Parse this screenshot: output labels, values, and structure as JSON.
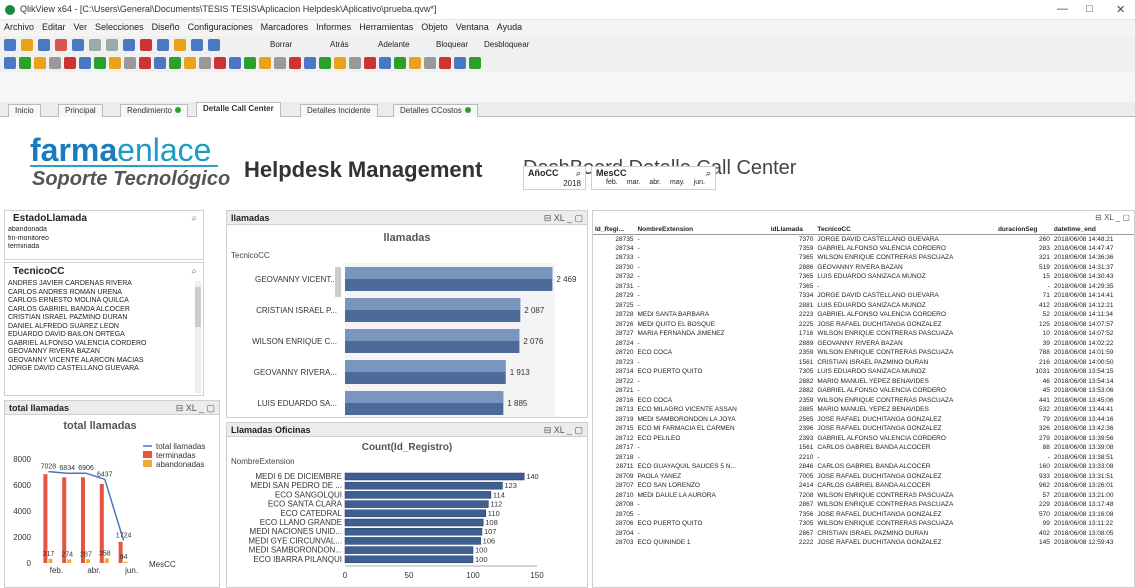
{
  "window": {
    "title": "QlikView x64 - [C:\\Users\\General\\Documents\\TESIS TESIS\\Aplicacion Helpdesk\\Aplicativo\\prueba.qvw*]",
    "min": "—",
    "max": "□",
    "close": "✕"
  },
  "menu": [
    "Archivo",
    "Editar",
    "Ver",
    "Selecciones",
    "Diseño",
    "Configuraciones",
    "Marcadores",
    "Informes",
    "Herramientas",
    "Objeto",
    "Ventana",
    "Ayuda"
  ],
  "toolbar": {
    "borrar": "Borrar",
    "atras": "Atrás",
    "adelante": "Adelante",
    "bloquear": "Bloquear",
    "desbloquear": "Desbloquear"
  },
  "tabs": [
    {
      "label": "Inicio"
    },
    {
      "label": "Principal"
    },
    {
      "label": "Rendimiento"
    },
    {
      "label": "Detalle Call Center"
    },
    {
      "label": "Detalles Incidente"
    },
    {
      "label": "Detalles CCostos"
    }
  ],
  "brand": {
    "farma": "farma",
    "enlace": "enlace",
    "sub": "Soporte Tecnológico"
  },
  "header": {
    "title": "Helpdesk Management",
    "subtitle": "DashBoard Detalle Call Center"
  },
  "anio": {
    "label": "AñoCC",
    "value": "2018"
  },
  "mes": {
    "label": "MesCC",
    "values": [
      "feb.",
      "mar.",
      "abr.",
      "may.",
      "jun."
    ]
  },
  "estado": {
    "title": "EstadoLlamada",
    "items": [
      "abandonada",
      "fin-monitoreo",
      "terminada"
    ]
  },
  "tecnico": {
    "title": "TecnicoCC",
    "items": [
      "ANDRES JAVIER CARDENAS RIVERA",
      "CARLOS ANDRES ROMAN URENA",
      "CARLOS ERNESTO MOLINA QUILCA",
      "CARLOS GABRIEL BANDA ALCOCER",
      "CRISTIAN ISRAEL PAZMINO DURAN",
      "DANIEL ALFREDO SUAREZ LEON",
      "EDUARDO DAVID BAILON ORTEGA",
      "GABRIEL ALFONSO VALENCIA CORDERO",
      "GEOVANNY RIVERA BAZAN",
      "GEOVANNY VICENTE ALARCON MACIAS",
      "JORGE DAVID CASTELLANO GUEVARA"
    ]
  },
  "llamadas_box": {
    "title": "llamadas",
    "chart_title": "llamadas",
    "dim": "TecnicoCC",
    "controls": "⊟ XL _ ▢"
  },
  "oficinas_box": {
    "title": "Llamadas Oficinas",
    "chart_title": "Count(Id_Registro)",
    "dim": "NombreExtension",
    "controls": "⊟ XL _ ▢"
  },
  "total_box": {
    "title": "total llamadas",
    "chart_title": "total llamadas",
    "xlabel": "MesCC",
    "controls": "⊟ XL _ ▢"
  },
  "detail": {
    "controls": "⊟ XL _ ▢",
    "columns": [
      "Id_Regi...",
      "NombreExtension",
      "idLlamada",
      "TecnicoCC",
      "duracionSeg",
      "datetime_end"
    ],
    "rows": [
      [
        "28735",
        "-",
        "7370",
        "JORGE DAVID CASTELLANO GUEVARA",
        "260",
        "2018/06/08 14:48:21"
      ],
      [
        "28734",
        "-",
        "7359",
        "GABRIEL ALFONSO VALENCIA CORDERO",
        "283",
        "2018/06/08 14:47:47"
      ],
      [
        "28733",
        "-",
        "7365",
        "WILSON ENRIQUE CONTRERAS PASCUAZA",
        "321",
        "2018/06/08 14:36:36"
      ],
      [
        "28730",
        "-",
        "2886",
        "GEOVANNY RIVERA BAZAN",
        "519",
        "2018/06/08 14:31:37"
      ],
      [
        "28732",
        "-",
        "7365",
        "LUIS EDUARDO SANIZACA MUNOZ",
        "15",
        "2018/06/08 14:30:43"
      ],
      [
        "28731",
        "-",
        "7365",
        "-",
        "-",
        "2018/06/08 14:29:35"
      ],
      [
        "28729",
        "-",
        "7334",
        "JORGE DAVID CASTELLANO GUEVARA",
        "71",
        "2018/06/08 14:14:41"
      ],
      [
        "28725",
        "-",
        "2881",
        "LUIS EDUARDO SANIZACA MUNOZ",
        "412",
        "2018/06/08 14:12:21"
      ],
      [
        "28728",
        "MEDI SANTA BARBARA",
        "2223",
        "GABRIEL ALFONSO VALENCIA CORDERO",
        "52",
        "2018/06/08 14:11:34"
      ],
      [
        "28726",
        "MEDI QUITO EL BOSQUE",
        "2225",
        "JOSE RAFAEL DUCHITANGA GONZALEZ",
        "125",
        "2018/06/08 14:07:57"
      ],
      [
        "28727",
        "MARIA FERNANDA JIMENEZ",
        "1716",
        "WILSON ENRIQUE CONTRERAS PASCUAZA",
        "10",
        "2018/06/08 14:07:52"
      ],
      [
        "28724",
        "-",
        "2889",
        "GEOVANNY RIVERA BAZAN",
        "39",
        "2018/06/08 14:02:22"
      ],
      [
        "28720",
        "ECO COCA",
        "2359",
        "WILSON ENRIQUE CONTRERAS PASCUAZA",
        "788",
        "2018/06/08 14:01:59"
      ],
      [
        "28723",
        "-",
        "1561",
        "CRISTIAN ISRAEL PAZMINO DURAN",
        "216",
        "2018/06/08 14:00:50"
      ],
      [
        "28714",
        "ECO PUERTO QUITO",
        "7305",
        "LUIS EDUARDO SANIZACA MUNOZ",
        "1031",
        "2018/06/08 13:54:15"
      ],
      [
        "28722",
        "-",
        "2882",
        "MARIO MANUEL YEPEZ BENAVIDES",
        "46",
        "2018/06/08 13:54:14"
      ],
      [
        "28721",
        "-",
        "2882",
        "GABRIEL ALFONSO VALENCIA CORDERO",
        "45",
        "2018/06/08 13:53:06"
      ],
      [
        "28716",
        "ECO COCA",
        "2359",
        "WILSON ENRIQUE CONTRERAS PASCUAZA",
        "441",
        "2018/06/08 13:45:06"
      ],
      [
        "28713",
        "ECO MILAGRO VICENTE ASSAN",
        "2885",
        "MARIO MANUEL YEPEZ BENAVIDES",
        "532",
        "2018/06/08 13:44:41"
      ],
      [
        "28719",
        "MEDI SAMBORONDON LA JOYA",
        "2565",
        "JOSE RAFAEL DUCHITANGA GONZALEZ",
        "79",
        "2018/06/08 13:44:16"
      ],
      [
        "28715",
        "ECO MI FARMACIA EL CARMEN",
        "2396",
        "JOSE RAFAEL DUCHITANGA GONZALEZ",
        "326",
        "2018/06/08 13:42:36"
      ],
      [
        "28712",
        "ECO PELILEO",
        "2393",
        "GABRIEL ALFONSO VALENCIA CORDERO",
        "279",
        "2018/06/08 13:39:56"
      ],
      [
        "28717",
        "-",
        "1561",
        "CARLOS GABRIEL BANDA ALCOCER",
        "88",
        "2018/06/08 13:39:08"
      ],
      [
        "28718",
        "-",
        "2210",
        "-",
        "-",
        "2018/06/08 13:38:51"
      ],
      [
        "28711",
        "ECO GUAYAQUIL SAUCES 5 N...",
        "2846",
        "CARLOS GABRIEL BANDA ALCOCER",
        "160",
        "2018/06/08 13:33:08"
      ],
      [
        "28709",
        "PAOLA YANEZ",
        "7005",
        "JOSE RAFAEL DUCHITANGA GONZALEZ",
        "933",
        "2018/06/08 13:31:51"
      ],
      [
        "28707",
        "ECO SAN LORENZO",
        "2414",
        "CARLOS GABRIEL BANDA ALCOCER",
        "962",
        "2018/06/08 13:26:01"
      ],
      [
        "28710",
        "MEDI DAULE LA AURORA",
        "7208",
        "WILSON ENRIQUE CONTRERAS PASCUAZA",
        "57",
        "2018/06/08 13:21:00"
      ],
      [
        "28708",
        "-",
        "2867",
        "WILSON ENRIQUE CONTRERAS PASCUAZA",
        "229",
        "2018/06/08 13:17:48"
      ],
      [
        "28705",
        "-",
        "7356",
        "JOSE RAFAEL DUCHITANGA GONZALEZ",
        "570",
        "2018/06/08 13:16:08"
      ],
      [
        "28706",
        "ECO PUERTO QUITO",
        "7305",
        "WILSON ENRIQUE CONTRERAS PASCUAZA",
        "99",
        "2018/06/08 13:11:22"
      ],
      [
        "28704",
        "-",
        "2867",
        "CRISTIAN ISRAEL PAZMINO DURAN",
        "402",
        "2018/06/08 13:08:05"
      ],
      [
        "28703",
        "ECO QUININDE 1",
        "2222",
        "JOSE RAFAEL DUCHITANGA GONZALEZ",
        "145",
        "2018/06/08 12:59:43"
      ]
    ]
  },
  "chart_data": [
    {
      "type": "bar",
      "title": "llamadas",
      "xlabel": "",
      "ylabel": "TecnicoCC",
      "categories": [
        "GEOVANNY VICENT...",
        "CRISTIAN ISRAEL P...",
        "WILSON ENRIQUE C...",
        "GEOVANNY RIVERA...",
        "LUIS EDUARDO SA..."
      ],
      "values": [
        2469,
        2087,
        2076,
        1913,
        1885
      ],
      "xlim": [
        0,
        2500
      ],
      "ticks": [
        "0",
        "500",
        "1 000",
        "1 500",
        "2 000",
        "2 500"
      ],
      "orientation": "horizontal"
    },
    {
      "type": "bar",
      "title": "Count(Id_Registro)",
      "ylabel": "NombreExtension",
      "categories": [
        "MEDI 6 DE DICIEMBRE",
        "MEDI SAN PEDRO DE ...",
        "ECO SANGOLQUI",
        "ECO SANTA CLARA",
        "ECO CATEDRAL",
        "ECO LLANO GRANDE",
        "MEDI NACIONES UNID...",
        "MEDI GYE CIRCUNVAL...",
        "MEDI SAMBORONDON...",
        "ECO IBARRA PILANQUI"
      ],
      "values": [
        140,
        123,
        114,
        112,
        110,
        108,
        107,
        106,
        100,
        100
      ],
      "xlim": [
        0,
        150
      ],
      "ticks": [
        "0",
        "50",
        "100",
        "150"
      ],
      "orientation": "horizontal"
    },
    {
      "type": "bar",
      "title": "total llamadas",
      "xlabel": "MesCC",
      "categories": [
        "feb.",
        "mar.",
        "abr.",
        "may.",
        "jun."
      ],
      "series": [
        {
          "name": "total llamadas",
          "values": [
            7028,
            6906,
            6906,
            6437,
            1724
          ]
        },
        {
          "name": "terminadas",
          "values": [
            6834,
            6591,
            6591,
            6079,
            1630
          ]
        },
        {
          "name": "abandonadas",
          "values": [
            317,
            274,
            287,
            358,
            94
          ]
        }
      ],
      "ylim": [
        0,
        8000
      ],
      "ticks": [
        "0",
        "2000",
        "4000",
        "6000",
        "8000"
      ],
      "labels": [
        "7028",
        "6834",
        "6906",
        "6437",
        "1724",
        "317",
        "274",
        "287",
        "358",
        "94"
      ]
    }
  ]
}
